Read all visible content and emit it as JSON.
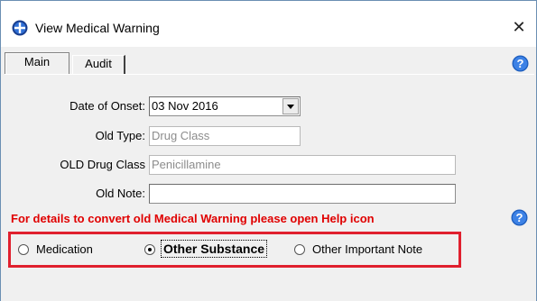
{
  "window": {
    "title": "View Medical Warning",
    "close_glyph": "✕"
  },
  "tabs": [
    {
      "label": "Main",
      "selected": true
    },
    {
      "label": "Audit",
      "selected": false
    }
  ],
  "form": {
    "date_of_onset": {
      "label": "Date of Onset:",
      "value": "03 Nov 2016"
    },
    "old_type": {
      "label": "Old Type:",
      "value": "Drug Class"
    },
    "old_drug_class": {
      "label": "OLD Drug Class",
      "value": "Penicillamine"
    },
    "old_note": {
      "label": "Old Note:",
      "value": ""
    }
  },
  "warning_text": "For details to convert old Medical Warning please open Help icon",
  "radios": [
    {
      "label": "Medication",
      "checked": false
    },
    {
      "label": "Other Substance",
      "checked": true
    },
    {
      "label": "Other Important Note",
      "checked": false
    }
  ],
  "icons": {
    "app": "app-globe-icon",
    "help": "help-icon",
    "close": "close-icon",
    "dropdown": "chevron-down-icon"
  },
  "colors": {
    "warning": "#e00000",
    "highlight_border": "#e0202e",
    "help_icon": "#1f5fbf"
  }
}
